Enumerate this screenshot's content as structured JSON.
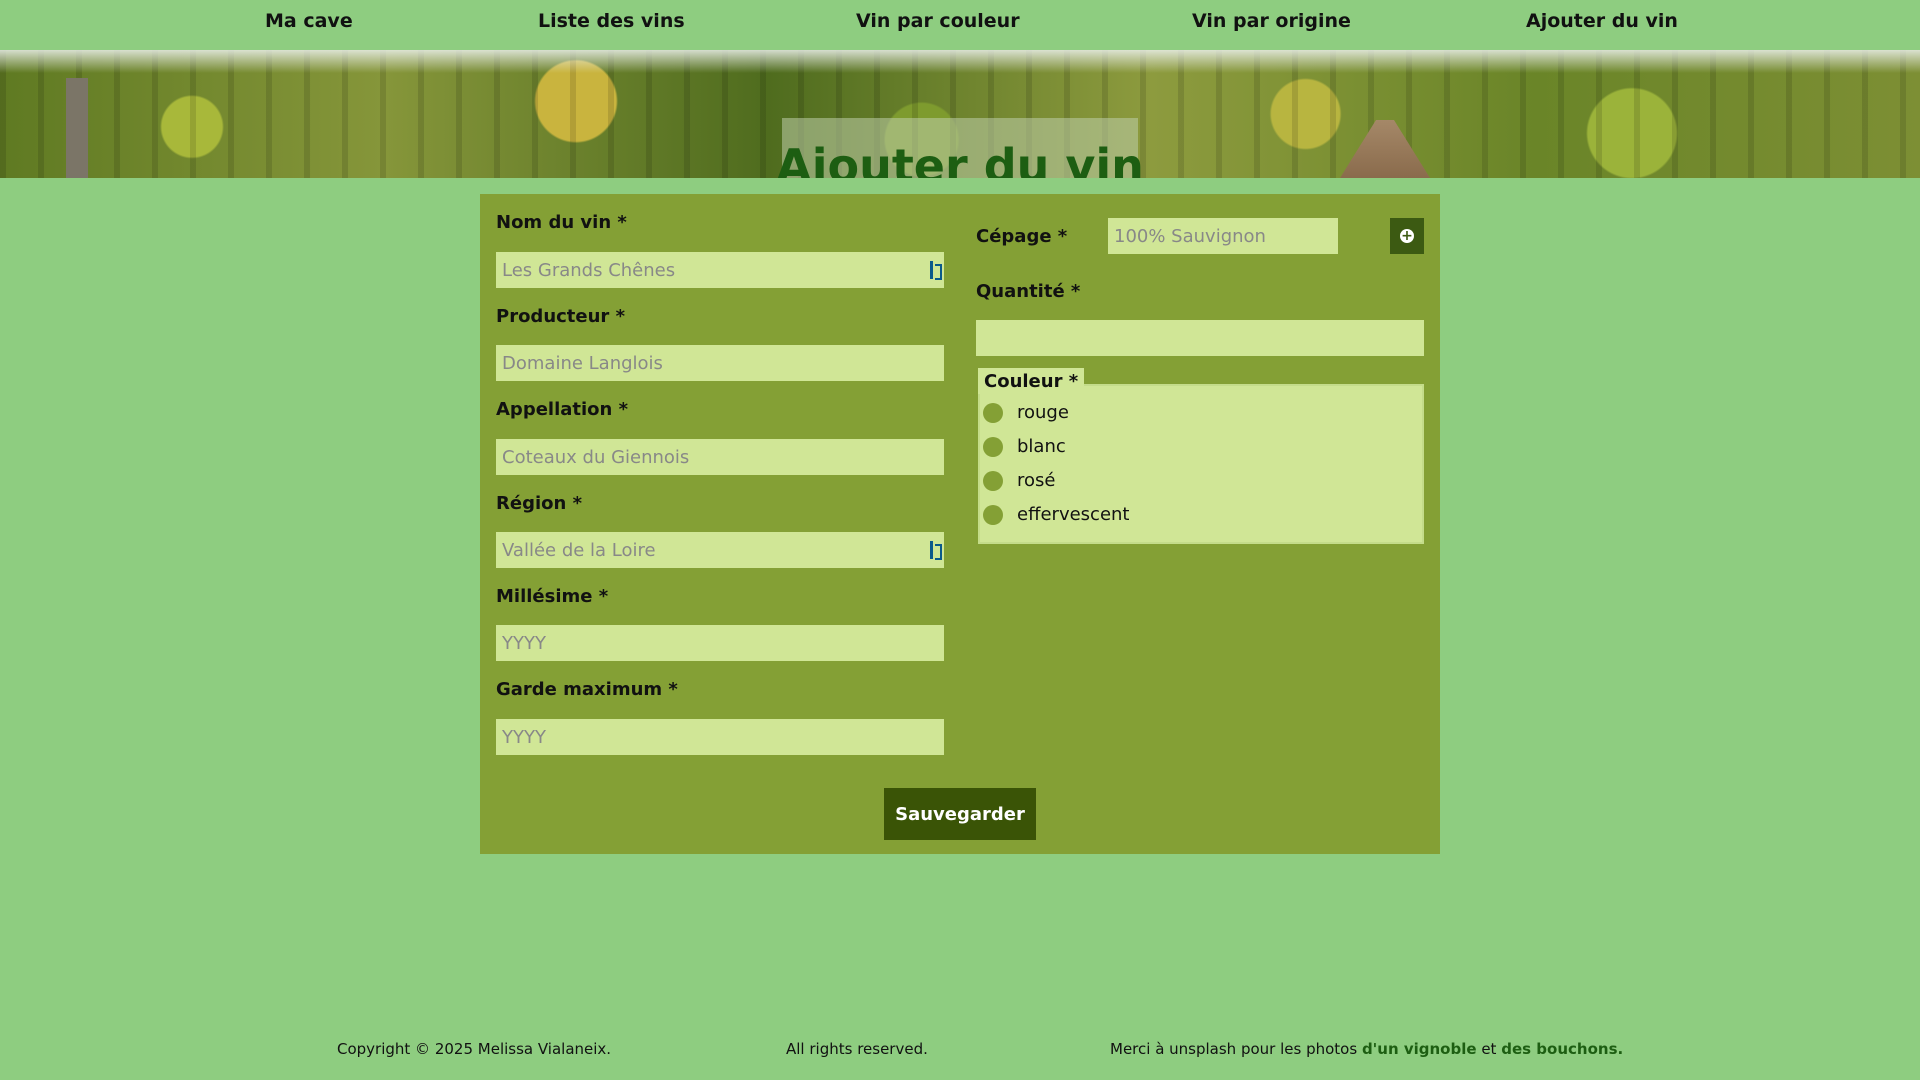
{
  "nav": {
    "items": [
      "Ma cave",
      "Liste des vins",
      "Vin par couleur",
      "Vin par origine",
      "Ajouter du vin"
    ]
  },
  "banner": {
    "title": "Ajouter du vin"
  },
  "form": {
    "fields": {
      "nom": {
        "label": "Nom du vin *",
        "placeholder": "Les Grands Chênes"
      },
      "producteur": {
        "label": "Producteur *",
        "placeholder": "Domaine Langlois"
      },
      "appellation": {
        "label": "Appellation *",
        "placeholder": "Coteaux du Giennois"
      },
      "region": {
        "label": "Région *",
        "placeholder": "Vallée de la Loire"
      },
      "millesime": {
        "label": "Millésime *",
        "placeholder": "YYYY"
      },
      "garde": {
        "label": "Garde maximum *",
        "placeholder": "YYYY"
      },
      "cepage": {
        "label": "Cépage *",
        "placeholder": "100% Sauvignon"
      },
      "quantite": {
        "label": "Quantité *",
        "placeholder": ""
      }
    },
    "couleur": {
      "legend": "Couleur *",
      "options": [
        "rouge",
        "blanc",
        "rosé",
        "effervescent"
      ]
    },
    "save_label": "Sauvegarder"
  },
  "footer": {
    "copyright": "Copyright © 2025 Melissa Vialaneix.",
    "rights": "All rights reserved.",
    "thanks_prefix": "Merci à unsplash pour les photos",
    "link_vignoble": "d'un vignoble",
    "et": "et",
    "link_bouchons": "des bouchons."
  },
  "colors": {
    "page_bg": "#8ecd80",
    "card_bg": "#84a035",
    "input_bg": "#d0e696",
    "button_bg": "#3a5406",
    "title_color": "#1d5e12"
  }
}
